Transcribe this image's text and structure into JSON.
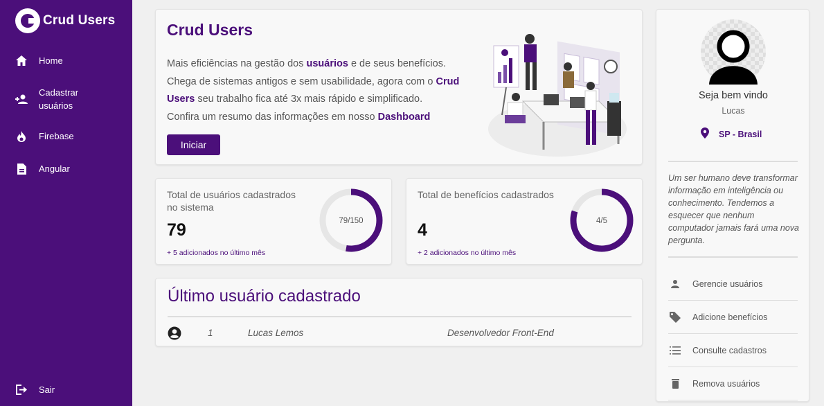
{
  "brand": {
    "name": "Crud Users"
  },
  "sidebar": {
    "items": [
      {
        "label": "Home",
        "icon": "home-icon"
      },
      {
        "label_line1": "Cadastrar",
        "label_line2": "usuários",
        "icon": "add-user-icon"
      },
      {
        "label": "Firebase",
        "icon": "flame-icon"
      },
      {
        "label": "Angular",
        "icon": "document-icon"
      }
    ],
    "logout": {
      "label": "Sair",
      "icon": "logout-icon"
    }
  },
  "hero": {
    "title": "Crud Users",
    "line1_a": "Mais eficiências na gestão dos ",
    "line1_b": "usuários",
    "line1_c": " e de seus benefícios.",
    "line2_a": "Chega de sistemas antigos e sem usabilidade, agora com o ",
    "line2_b": "Crud Users",
    "line2_c": " seu trabalho fica até 3x mais rápido e simplificado.",
    "line3_a": "Confira um resumo das informações em nosso ",
    "line3_b": "Dashboard",
    "button": "Iniciar"
  },
  "stats": {
    "users": {
      "label": "Total de usuários cadastrados no sistema",
      "value": "79",
      "ring_text": "79/150",
      "progress": 0.527,
      "foot": "+ 5 adicionados no último mês"
    },
    "benefits": {
      "label": "Total de benefícios cadastrados",
      "value": "4",
      "ring_text": "4/5",
      "progress": 0.8,
      "foot": "+ 2 adicionados no último mês"
    }
  },
  "last_user": {
    "title": "Último usuário cadastrado",
    "id": "1",
    "name": "Lucas Lemos",
    "role": "Desenvolvedor Front-End"
  },
  "profile": {
    "welcome": "Seja bem vindo",
    "name": "Lucas",
    "location": "SP - Brasil",
    "quote": "Um ser humano deve transformar informação em inteligência ou conhecimento. Tendemos a esquecer que nenhum computador jamais fará uma nova pergunta.",
    "actions": [
      {
        "label": "Gerencie usuários",
        "icon": "person-icon"
      },
      {
        "label": "Adicione benefícios",
        "icon": "tag-icon"
      },
      {
        "label": "Consulte cadastros",
        "icon": "list-icon"
      },
      {
        "label": "Remova usuários",
        "icon": "trash-icon"
      }
    ]
  },
  "colors": {
    "primary": "#4b0f7a",
    "background": "#f0f0f0",
    "card": "#f8f8f8"
  }
}
